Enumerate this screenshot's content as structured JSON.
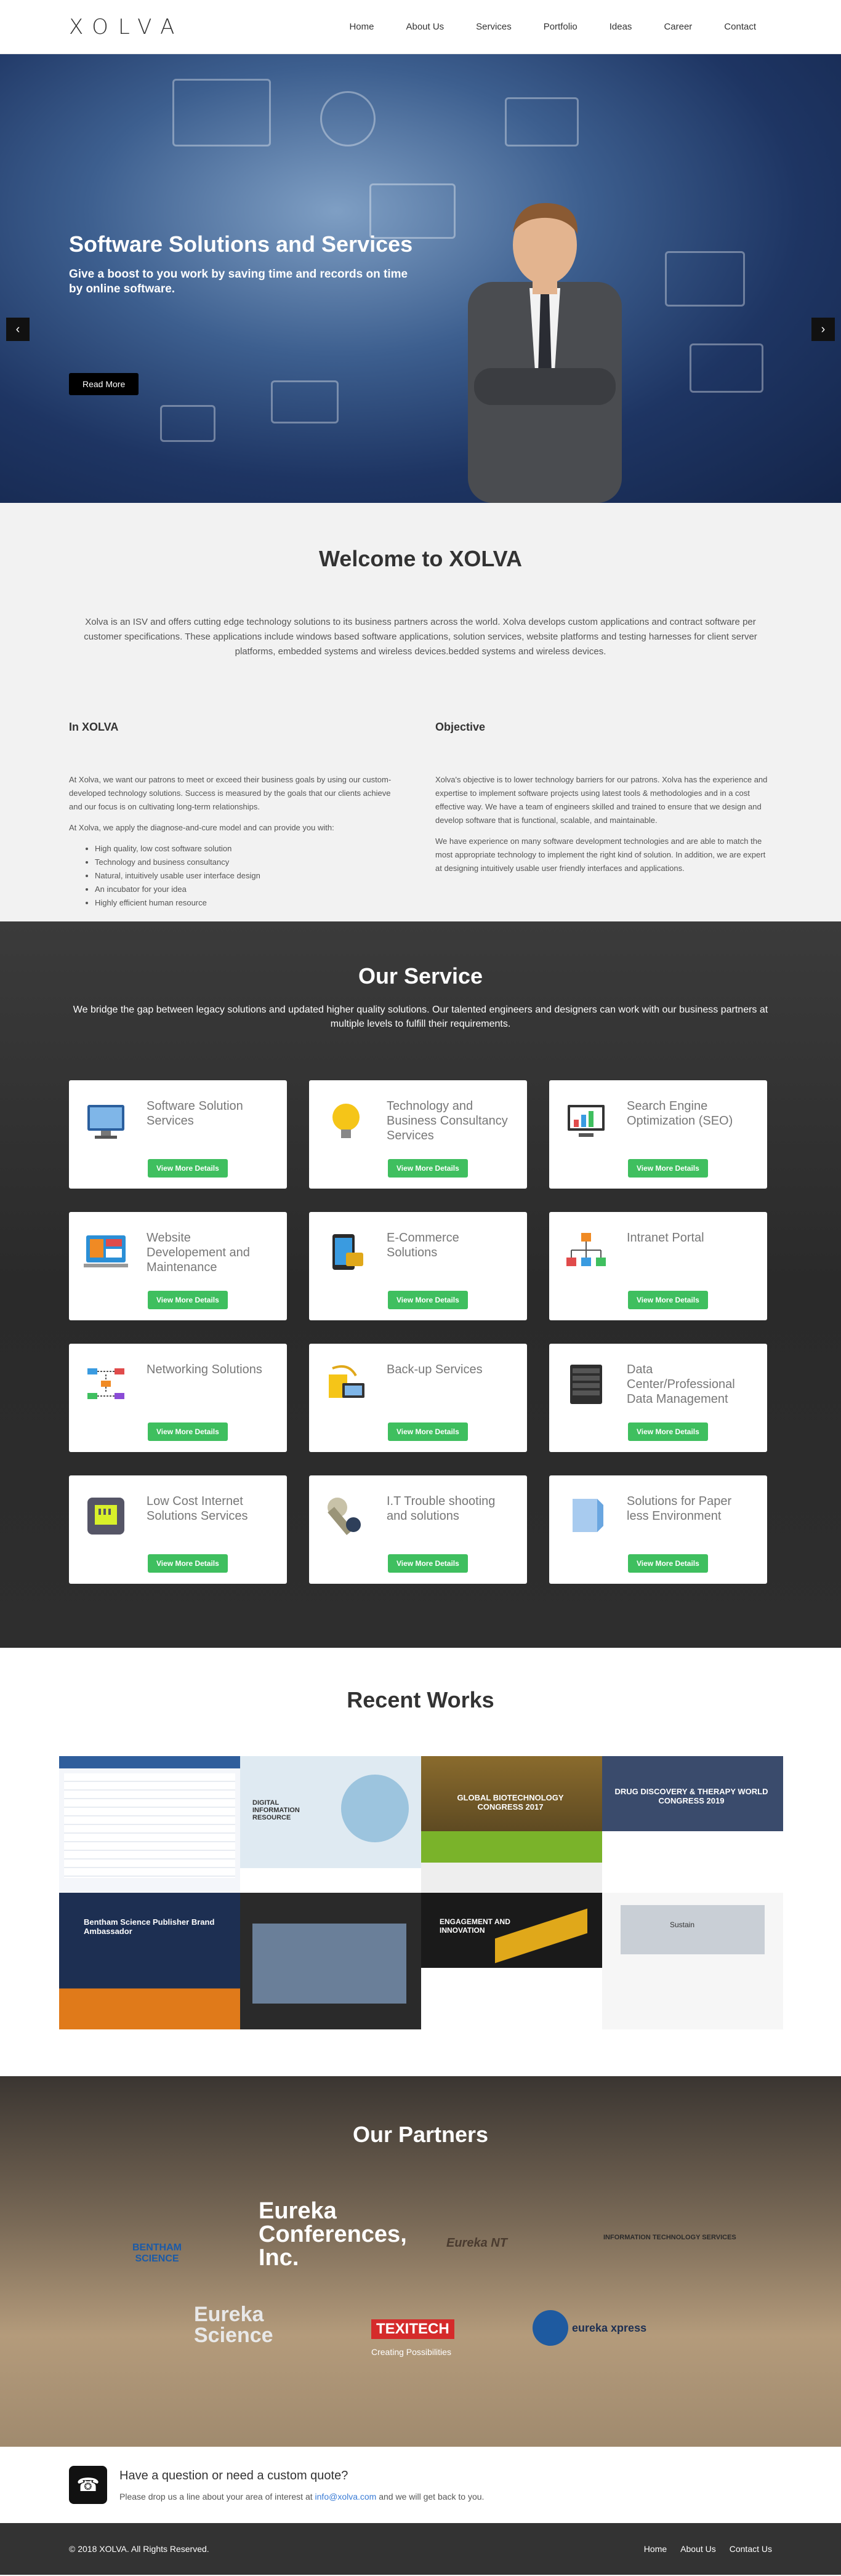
{
  "logo": "XOLVA",
  "nav": [
    "Home",
    "About Us",
    "Services",
    "Portfolio",
    "Ideas",
    "Career",
    "Contact"
  ],
  "hero": {
    "title": "Software Solutions and Services",
    "subtitle": "Give a boost to you work by saving time and records on time by online software.",
    "button": "Read More",
    "slides": 3,
    "active_slide": 1
  },
  "welcome": {
    "title": "Welcome to XOLVA",
    "text": "Xolva is an ISV and offers cutting edge technology solutions to its business partners across the world. Xolva develops custom applications and contract software per customer specifications. These applications include windows based software applications, solution services, website platforms and testing harnesses for client server platforms, embedded systems and wireless devices.bedded systems and wireless devices.",
    "in_title": "In XOLVA",
    "in_p1": "At Xolva, we want our patrons to meet or exceed their business goals by using our custom-developed technology solutions. Success is measured by the goals that our clients achieve and our focus is on cultivating long-term relationships.",
    "in_p2": "At Xolva, we apply the diagnose-and-cure model and can provide you with:",
    "in_list": [
      "High quality, low cost software solution",
      "Technology and business consultancy",
      "Natural, intuitively usable user interface design",
      "An incubator for your idea",
      "Highly efficient human resource"
    ],
    "obj_title": "Objective",
    "obj_p1": "Xolva's objective is to lower technology barriers for our patrons. Xolva has the experience and expertise to implement software projects using latest tools & methodologies and in a cost effective way. We have a team of engineers skilled and trained to ensure that we design and develop software that is functional, scalable, and maintainable.",
    "obj_p2": "We have experience on many software development technologies and are able to match the most appropriate technology to implement the right kind of solution. In addition, we are expert at designing intuitively usable user friendly interfaces and applications."
  },
  "services": {
    "title": "Our Service",
    "lead": "We bridge the gap between legacy solutions and updated higher quality solutions. Our talented engineers and designers can work with our business partners at multiple levels to fulfill their requirements.",
    "button": "View More Details",
    "items": [
      {
        "label": "Software Solution Services",
        "icon": "monitor-icon"
      },
      {
        "label": "Technology and Business Consultancy Services",
        "icon": "lightbulb-icon"
      },
      {
        "label": "Search Engine Optimization (SEO)",
        "icon": "chart-monitor-icon"
      },
      {
        "label": "Website Developement and Maintenance",
        "icon": "web-dev-icon"
      },
      {
        "label": "E-Commerce Solutions",
        "icon": "ecommerce-icon"
      },
      {
        "label": "Intranet Portal",
        "icon": "network-tree-icon"
      },
      {
        "label": "Networking Solutions",
        "icon": "networking-icon"
      },
      {
        "label": "Back-up Services",
        "icon": "backup-icon"
      },
      {
        "label": "Data Center/Professional Data Management",
        "icon": "server-rack-icon"
      },
      {
        "label": "Low Cost Internet Solutions Services",
        "icon": "ethernet-icon"
      },
      {
        "label": "I.T Trouble shooting and solutions",
        "icon": "wrench-icon"
      },
      {
        "label": "Solutions for Paper less Environment",
        "icon": "paperless-icon"
      }
    ]
  },
  "works": {
    "title": "Recent Works",
    "items": [
      {
        "label": ""
      },
      {
        "label": "DIGITAL INFORMATION RESOURCE"
      },
      {
        "label": "GLOBAL BIOTECHNOLOGY CONGRESS 2017"
      },
      {
        "label": "DRUG DISCOVERY & THERAPY WORLD CONGRESS 2019"
      },
      {
        "label": "Bentham Science Publisher Brand Ambassador"
      },
      {
        "label": ""
      },
      {
        "label": "ENGAGEMENT AND INNOVATION"
      },
      {
        "label": "Sustain"
      }
    ]
  },
  "partners": {
    "title": "Our Partners",
    "logos": [
      "BENTHAM SCIENCE",
      "Eureka Conferences, Inc.",
      "Eureka NT",
      "INFORMATION TECHNOLOGY SERVICES",
      "Eureka Science",
      "TEXITECH",
      "Creating Possibilities",
      "eureka xpress"
    ]
  },
  "quote": {
    "title": "Have a question or need a custom quote?",
    "text_before": "Please drop us a line about your area of interest at",
    "email": "info@xolva.com",
    "text_after": "and we will get back to you."
  },
  "footer": {
    "copyright": "© 2018 XOLVA. All Rights Reserved.",
    "links": [
      "Home",
      "About Us",
      "Contact Us"
    ]
  },
  "colors": {
    "accent": "#3fbf5f",
    "dark": "#333333",
    "link": "#3a7bd5"
  }
}
